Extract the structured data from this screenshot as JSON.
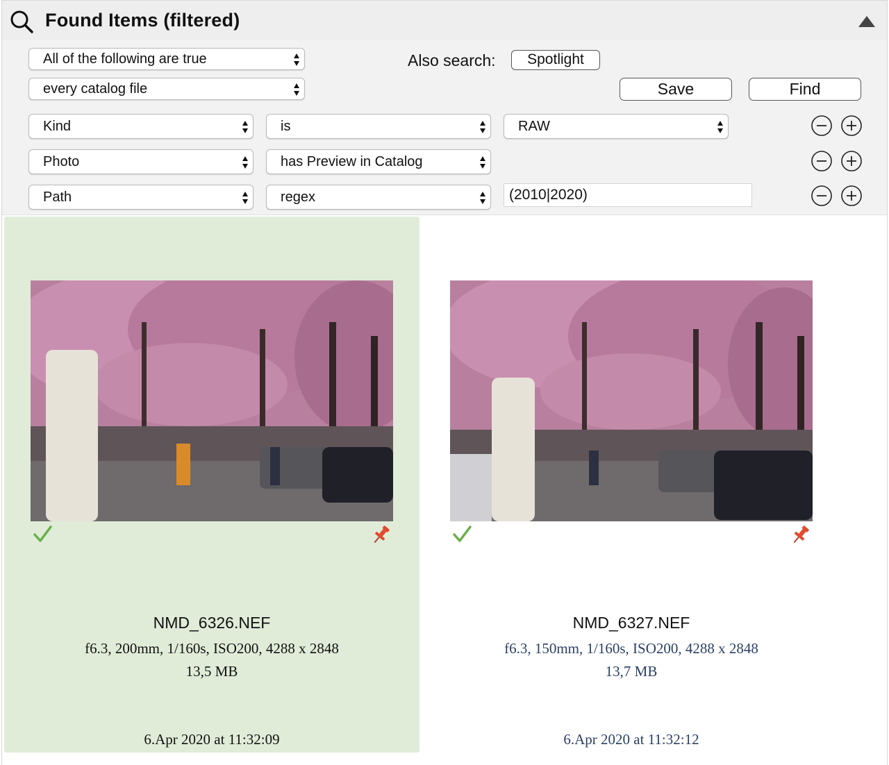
{
  "header": {
    "title": "Found Items  (filtered)"
  },
  "criteria": {
    "match_mode": "All of the following are true",
    "scope": "every catalog file",
    "also_search_label": "Also search:",
    "spotlight_label": "Spotlight",
    "save_label": "Save",
    "find_label": "Find",
    "rules": [
      {
        "field": "Kind",
        "operator": "is",
        "value": "RAW",
        "value_type": "popup"
      },
      {
        "field": "Photo",
        "operator": "has Preview in Catalog",
        "value": "",
        "value_type": "none"
      },
      {
        "field": "Path",
        "operator": "regex",
        "value": "(2010|2020)",
        "value_type": "text"
      }
    ]
  },
  "results": [
    {
      "filename": "NMD_6326.NEF",
      "exif": "f6.3, 200mm, 1/160s, ISO200, 4288 x 2848",
      "size": "13,5 MB",
      "date": "6.Apr 2020 at 11:32:09",
      "selected": true,
      "checked": true,
      "pinned": true
    },
    {
      "filename": "NMD_6327.NEF",
      "exif": "f6.3, 150mm, 1/160s, ISO200, 4288 x 2848",
      "size": "13,7 MB",
      "date": "6.Apr 2020 at 11:32:12",
      "selected": false,
      "checked": true,
      "pinned": true
    }
  ],
  "colors": {
    "selection_bg": "#e0ecd8",
    "check_green": "#6ab04c",
    "pin_red": "#e04a2f",
    "meta_blue": "#2b3f63"
  }
}
